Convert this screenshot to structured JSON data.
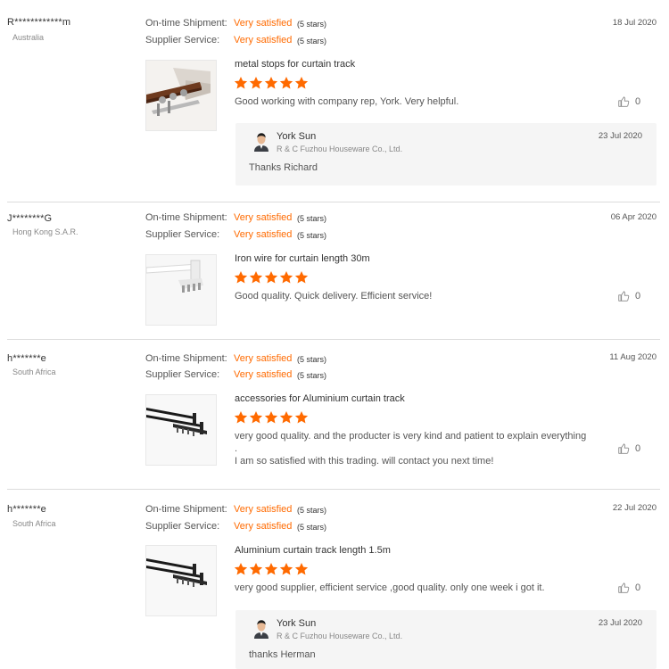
{
  "colors": {
    "accent": "#ff6a00",
    "divider": "#dcdcdc",
    "reply_bg": "#f5f5f5"
  },
  "labels": {
    "ontime": "On-time Shipment:",
    "supplier": "Supplier Service:"
  },
  "reviews": [
    {
      "user": "R************m",
      "country": "Australia",
      "date": "18 Jul 2020",
      "ontime_value": "Very satisfied",
      "ontime_stars": "(5 stars)",
      "supplier_value": "Very satisfied",
      "supplier_stars": "(5 stars)",
      "product": "metal stops for curtain track",
      "rating": 5,
      "comment": "Good working with company rep, York.  Very helpful.",
      "likes": "0",
      "image_icon": "curtain-rod-wood-bracket",
      "reply": {
        "name": "York Sun",
        "company": "R & C Fuzhou Houseware Co., Ltd.",
        "date": "23 Jul 2020",
        "text": "Thanks Richard"
      }
    },
    {
      "user": "J********G",
      "country": "Hong Kong S.A.R.",
      "date": "06 Apr 2020",
      "ontime_value": "Very satisfied",
      "ontime_stars": "(5 stars)",
      "supplier_value": "Very satisfied",
      "supplier_stars": "(5 stars)",
      "product": "Iron wire for curtain length 30m",
      "rating": 5,
      "comment": "Good quality.  Quick delivery. Efficient service!",
      "likes": "0",
      "image_icon": "white-curtain-track"
    },
    {
      "user": "h*******e",
      "country": "South Africa",
      "date": "11 Aug 2020",
      "ontime_value": "Very satisfied",
      "ontime_stars": "(5 stars)",
      "supplier_value": "Very satisfied",
      "supplier_stars": "(5 stars)",
      "product": "accessories for Aluminium curtain track",
      "rating": 5,
      "comment_line1": "very good quality. and the producter is very kind and patient to explain everything .",
      "comment_line2": "I am so satisfied with this trading. will contact you next time!",
      "likes": "0",
      "image_icon": "black-curtain-track"
    },
    {
      "user": "h*******e",
      "country": "South Africa",
      "date": "22 Jul 2020",
      "ontime_value": "Very satisfied",
      "ontime_stars": "(5 stars)",
      "supplier_value": "Very satisfied",
      "supplier_stars": "(5 stars)",
      "product": "Aluminium curtain track length 1.5m",
      "rating": 5,
      "comment": "very good supplier, efficient service ,good quality. only one week i got it.",
      "likes": "0",
      "image_icon": "black-curtain-track",
      "reply": {
        "name": "York Sun",
        "company": "R & C Fuzhou Houseware Co., Ltd.",
        "date": "23 Jul 2020",
        "text": "thanks Herman"
      }
    }
  ]
}
